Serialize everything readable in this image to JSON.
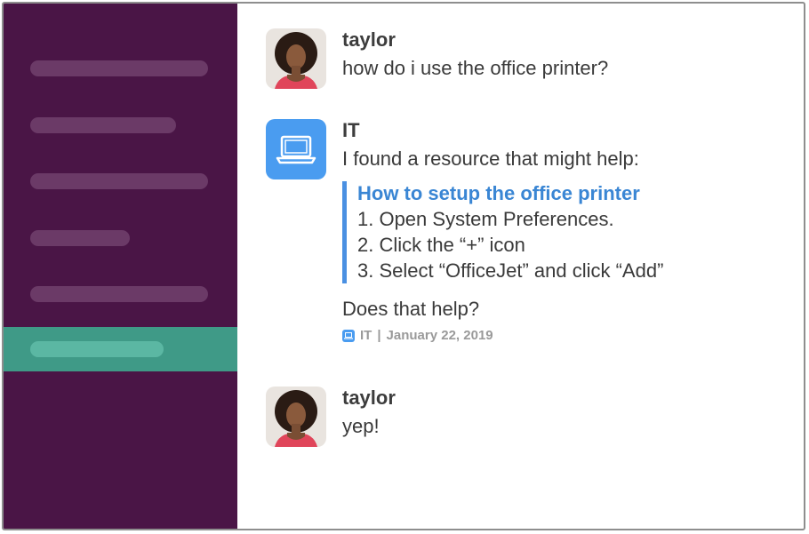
{
  "colors": {
    "sidebar_bg": "#4a1546",
    "sidebar_item": "#6b3a67",
    "sidebar_active": "#3f9a87",
    "link": "#3a86d4",
    "it_avatar": "#4a9cf0"
  },
  "sidebar": {
    "items": [
      "placeholder-1",
      "placeholder-2",
      "placeholder-3",
      "placeholder-4",
      "placeholder-5",
      "placeholder-active"
    ]
  },
  "messages": [
    {
      "sender": "taylor",
      "text": "how do i use the office printer?",
      "avatar": "user-photo"
    },
    {
      "sender": "IT",
      "text": "I found a resource that might help:",
      "avatar": "laptop-icon",
      "attachment": {
        "title": "How to setup the office printer",
        "steps": [
          "1. Open System Preferences.",
          "2. Click the “+” icon",
          "3. Select “OfficeJet” and click “Add”"
        ]
      },
      "followup": "Does that help?",
      "footer": {
        "source": "IT",
        "separator": "|",
        "date": "January 22, 2019"
      }
    },
    {
      "sender": "taylor",
      "text": "yep!",
      "avatar": "user-photo"
    }
  ]
}
